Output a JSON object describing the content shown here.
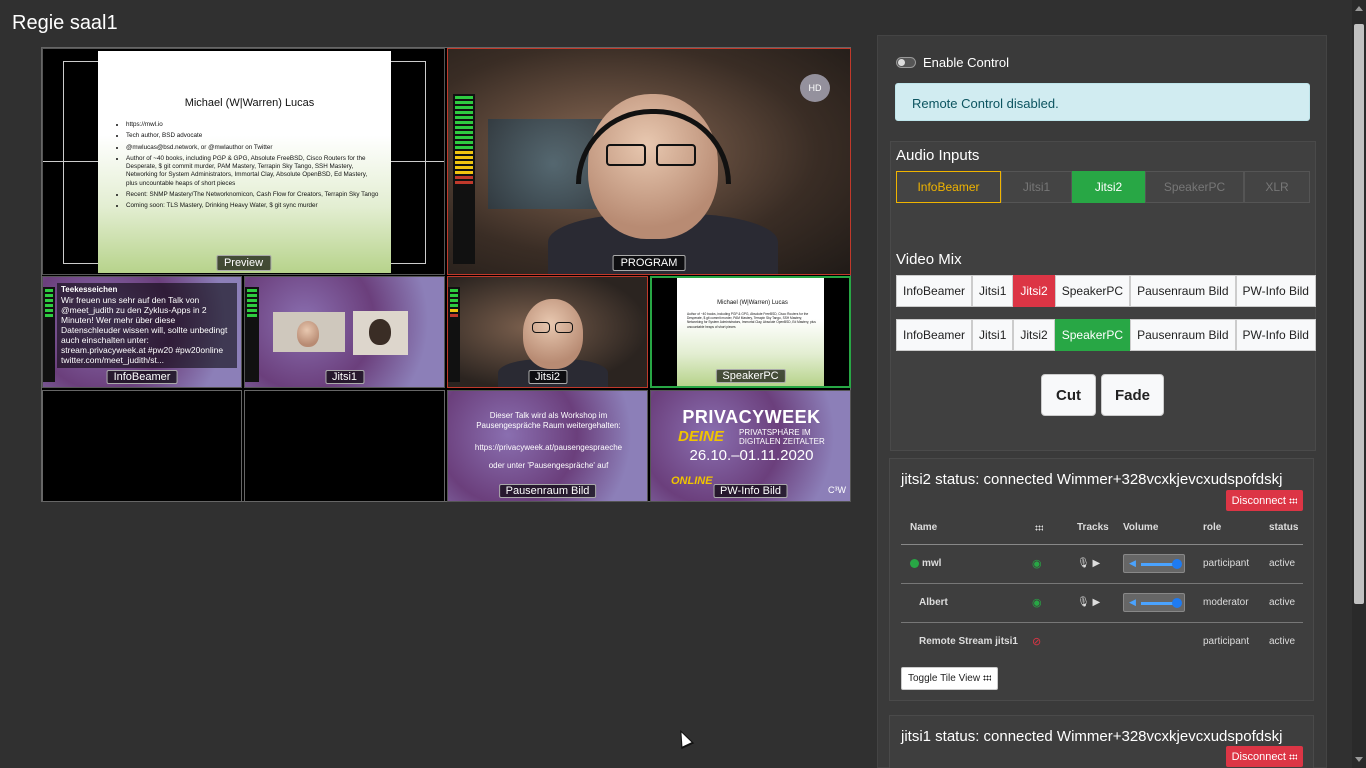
{
  "page": {
    "title": "Regie saal1"
  },
  "multiview": {
    "preview": {
      "label": "Preview",
      "slide_title": "Michael (W|Warren) Lucas",
      "bullets": [
        "https://mwl.io",
        "Tech author, BSD advocate",
        "@mwlucas@bsd.network, or @mwlauthor on Twitter",
        "Author of ~40 books, including PGP & GPG, Absolute FreeBSD, Cisco Routers for the Desperate, $ git commit murder, PAM Mastery, Terrapin Sky Tango, SSH Mastery, Networking for System Administrators, Immortal Clay, Absolute OpenBSD, Ed Mastery, plus uncountable heaps of short pieces",
        "Recent: SNMP Mastery/The Networknomicon, Cash Flow for Creators, Terrapin Sky Tango",
        "Coming soon: TLS Mastery, Drinking Heavy Water, $ git sync murder"
      ]
    },
    "program": {
      "label": "PROGRAM",
      "badge": "HD"
    },
    "sources": [
      {
        "label": "InfoBeamer",
        "name": "Teekesseichen",
        "text": "Wir freuen uns sehr auf den Talk von @meet_judith zu den Zyklus-Apps in 2 Minuten! Wer mehr über diese Datenschleuder wissen will, sollte unbedingt auch einschalten unter: stream.privacyweek.at #pw20 #pw20online twitter.com/meet_judith/st..."
      },
      {
        "label": "Jitsi1"
      },
      {
        "label": "Jitsi2"
      },
      {
        "label": "SpeakerPC"
      },
      {
        "label": ""
      },
      {
        "label": ""
      },
      {
        "label": "Pausenraum Bild",
        "text1": "Dieser Talk wird als Workshop im Pausengespräche Raum weitergehalten:",
        "text2": "https://privacyweek.at/pausengespraeche",
        "text3": "oder unter 'Pausengespräche' auf"
      },
      {
        "label": "PW-Info Bild",
        "line1": "PRIVACYWEEK",
        "line2": "DEINE",
        "line3a": "PRIVATSPHÄRE IM",
        "line3b": "DIGITALEN ZEITALTER",
        "line4": "26.10.–01.11.2020",
        "line5": "ONLINE",
        "logo": "C³W"
      }
    ]
  },
  "control": {
    "enable_label": "Enable Control",
    "alert": "Remote Control disabled.",
    "audio": {
      "title": "Audio Inputs",
      "buttons": [
        "InfoBeamer",
        "Jitsi1",
        "Jitsi2",
        "SpeakerPC",
        "XLR"
      ]
    },
    "video": {
      "title": "Video Mix",
      "row1": [
        "InfoBeamer",
        "Jitsi1",
        "Jitsi2",
        "SpeakerPC",
        "Pausenraum Bild",
        "PW-Info Bild"
      ],
      "row2": [
        "InfoBeamer",
        "Jitsi1",
        "Jitsi2",
        "SpeakerPC",
        "Pausenraum Bild",
        "PW-Info Bild"
      ]
    },
    "cut": "Cut",
    "fade": "Fade"
  },
  "jitsi2": {
    "status": "jitsi2 status: connected Wimmer+328vcxkjevcxudspofdskj",
    "disconnect": "Disconnect",
    "columns": [
      "Name",
      "",
      "Tracks",
      "Volume",
      "role",
      "status"
    ],
    "rows": [
      {
        "name": "mwl",
        "role": "participant",
        "status": "active"
      },
      {
        "name": "Albert",
        "role": "moderator",
        "status": "active"
      },
      {
        "name": "Remote Stream jitsi1",
        "role": "participant",
        "status": "active"
      }
    ],
    "toggle": "Toggle Tile View"
  },
  "jitsi1": {
    "status": "jitsi1 status: connected Wimmer+328vcxkjevcxudspofdskj",
    "disconnect": "Disconnect"
  },
  "colors": {
    "green": "#28a745",
    "red": "#dc3545",
    "amber": "#f0b400",
    "alert_bg": "#d1ecf1"
  }
}
